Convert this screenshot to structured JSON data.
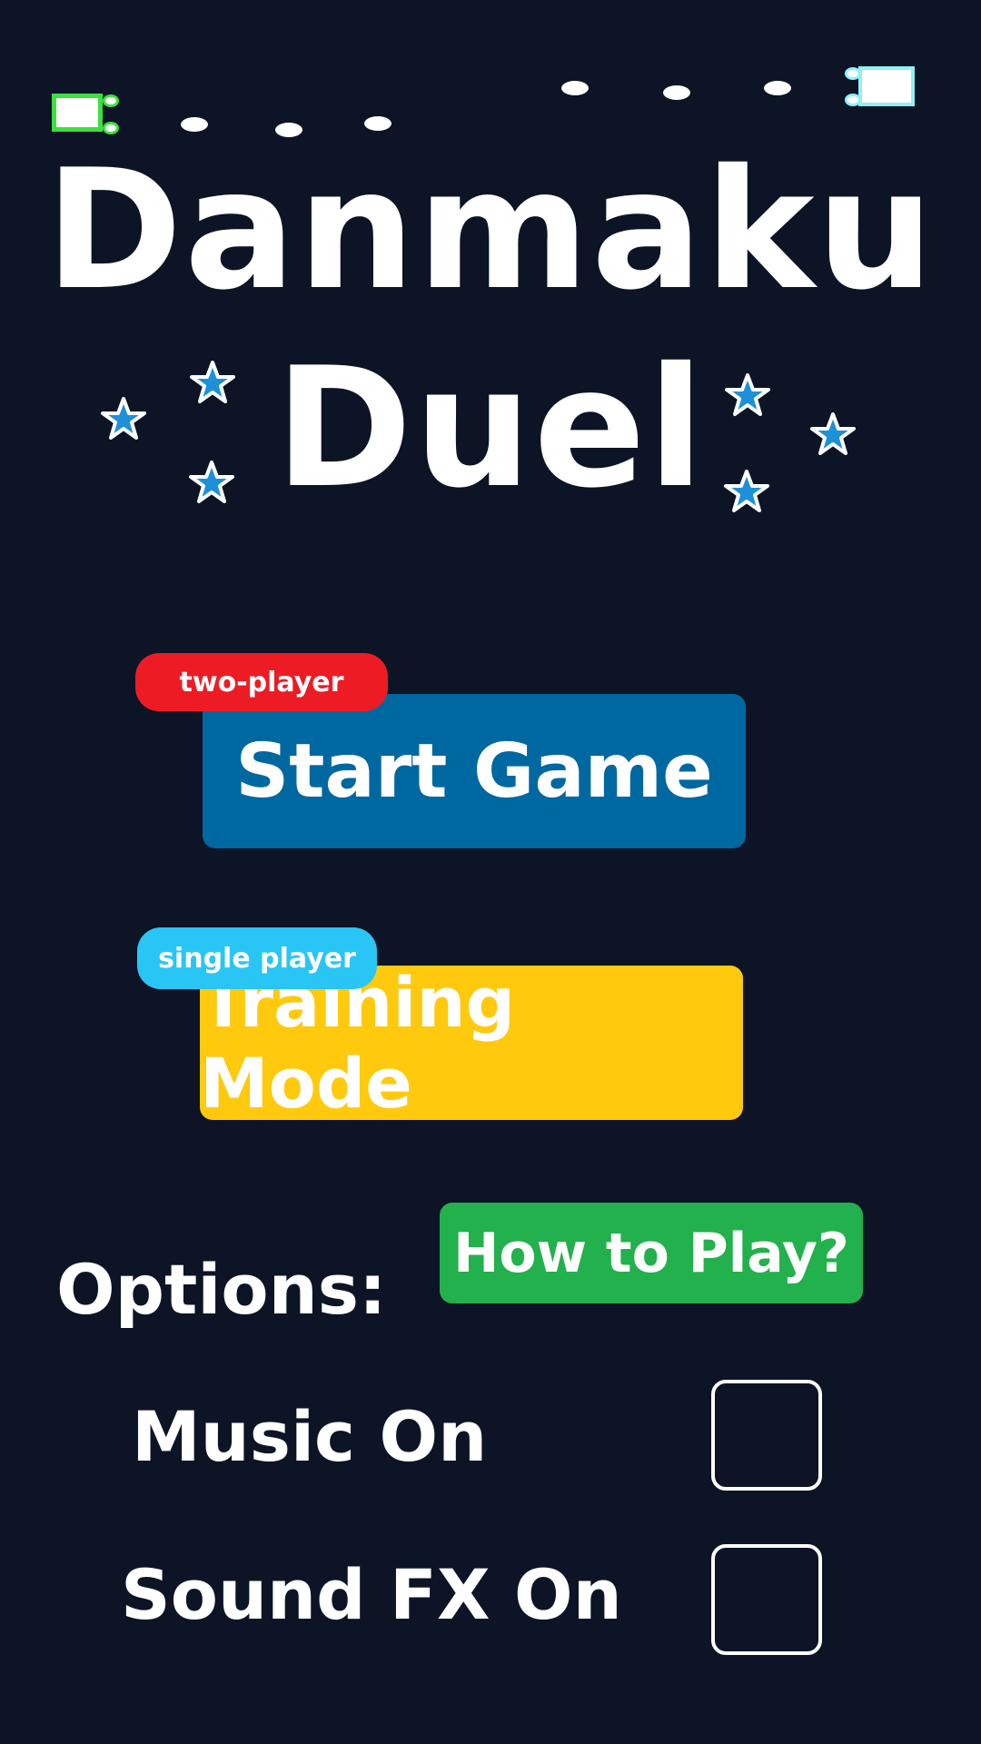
{
  "title": {
    "line1": "Danmaku",
    "line2": "Duel"
  },
  "menu": {
    "start_button": {
      "label": "Start Game",
      "tag": "two-player",
      "color": "#0068a0",
      "tag_color": "#ed1c24"
    },
    "training_button": {
      "label": "Training Mode",
      "tag": "single player",
      "color": "#ffc90e",
      "tag_color": "#29c6f5"
    },
    "howto_button": {
      "label": "How to Play?",
      "color": "#22b14c"
    }
  },
  "options": {
    "heading": "Options:",
    "music": {
      "label": "Music On",
      "checked": false
    },
    "sound_fx": {
      "label": "Sound FX On",
      "checked": false
    }
  },
  "colors": {
    "background": "#0c1426",
    "star": "#1e90d8",
    "player1_ship": "#3ee03e",
    "player2_ship": "#8ef1f5"
  },
  "icons": [
    "star-icon",
    "player-ship-icon",
    "bullet-icon"
  ]
}
